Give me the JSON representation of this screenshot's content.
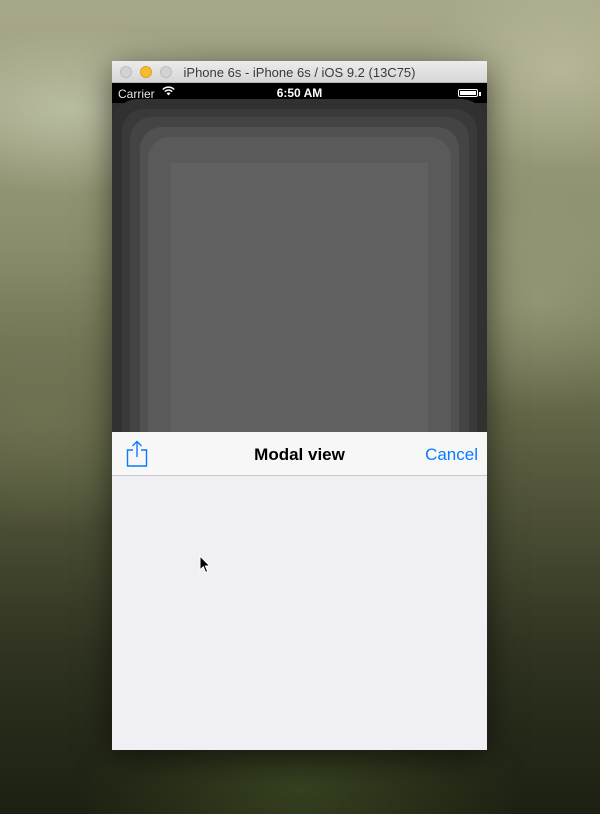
{
  "window": {
    "title": "iPhone 6s - iPhone 6s / iOS 9.2 (13C75)"
  },
  "status_bar": {
    "carrier": "Carrier",
    "time": "6:50 AM",
    "battery_level": 1.0
  },
  "modal": {
    "title": "Modal view",
    "cancel_label": "Cancel",
    "share_icon": "share-icon"
  },
  "colors": {
    "ios_blue": "#0a7aff",
    "modal_background": "#efeff4",
    "navbar_background": "#f7f7f7",
    "minimize_button": "#f5bd2e"
  }
}
